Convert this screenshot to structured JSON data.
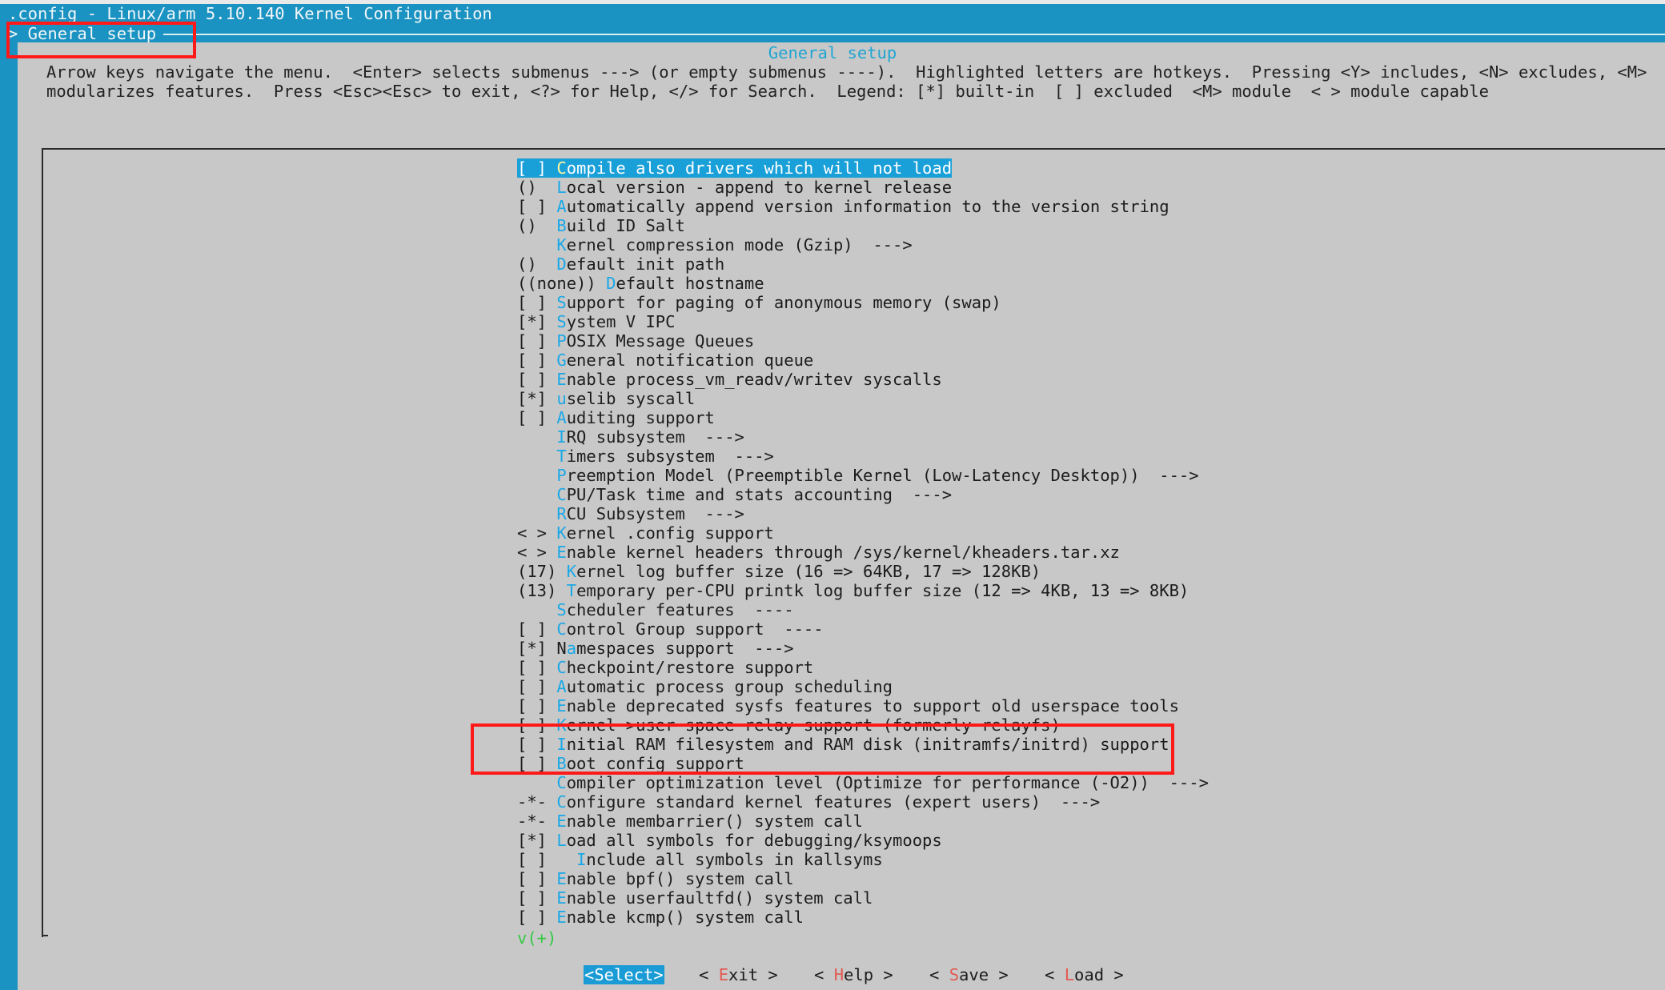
{
  "window": {
    "title": ".config - Linux/arm 5.10.140 Kernel Configuration"
  },
  "breadcrumb": {
    "text": "> General setup"
  },
  "panel": {
    "title": "General setup",
    "help_line_1": "Arrow keys navigate the menu.  <Enter> selects submenus ---> (or empty submenus ----).  Highlighted letters are hotkeys.  Pressing <Y> includes, <N> excludes, <M>",
    "help_line_2": "modularizes features.  Press <Esc><Esc> to exit, <?> for Help, </> for Search.  Legend: [*] built-in  [ ] excluded  <M> module  < > module capable"
  },
  "menu": {
    "items": [
      {
        "prefix": "[ ] ",
        "hotkey": "C",
        "rest": "ompile also drivers which will not load"
      },
      {
        "prefix": "()  ",
        "hotkey": "L",
        "rest": "ocal version - append to kernel release"
      },
      {
        "prefix": "[ ] ",
        "hotkey": "A",
        "rest": "utomatically append version information to the version string"
      },
      {
        "prefix": "()  ",
        "hotkey": "B",
        "rest": "uild ID Salt"
      },
      {
        "prefix": "    ",
        "hotkey": "K",
        "rest": "ernel compression mode (Gzip)  --->"
      },
      {
        "prefix": "()  ",
        "hotkey": "D",
        "rest": "efault init path"
      },
      {
        "prefix": "((none)) ",
        "hotkey": "D",
        "rest": "efault hostname"
      },
      {
        "prefix": "[ ] ",
        "hotkey": "S",
        "rest": "upport for paging of anonymous memory (swap)"
      },
      {
        "prefix": "[*] ",
        "hotkey": "S",
        "rest": "ystem V IPC"
      },
      {
        "prefix": "[ ] ",
        "hotkey": "P",
        "rest": "OSIX Message Queues"
      },
      {
        "prefix": "[ ] ",
        "hotkey": "G",
        "rest": "eneral notification queue"
      },
      {
        "prefix": "[ ] ",
        "hotkey": "E",
        "rest": "nable process_vm_readv/writev syscalls"
      },
      {
        "prefix": "[*] ",
        "hotkey": "u",
        "rest": "selib syscall"
      },
      {
        "prefix": "[ ] ",
        "hotkey": "A",
        "rest": "uditing support"
      },
      {
        "prefix": "    ",
        "hotkey": "I",
        "rest": "RQ subsystem  --->"
      },
      {
        "prefix": "    ",
        "hotkey": "T",
        "rest": "imers subsystem  --->"
      },
      {
        "prefix": "    ",
        "hotkey": "P",
        "rest": "reemption Model (Preemptible Kernel (Low-Latency Desktop))  --->"
      },
      {
        "prefix": "    ",
        "hotkey": "C",
        "rest": "PU/Task time and stats accounting  --->"
      },
      {
        "prefix": "    ",
        "hotkey": "R",
        "rest": "CU Subsystem  --->"
      },
      {
        "prefix": "< > ",
        "hotkey": "K",
        "rest": "ernel .config support"
      },
      {
        "prefix": "< > ",
        "hotkey": "E",
        "rest": "nable kernel headers through /sys/kernel/kheaders.tar.xz"
      },
      {
        "prefix": "(17) ",
        "hotkey": "K",
        "rest": "ernel log buffer size (16 => 64KB, 17 => 128KB)"
      },
      {
        "prefix": "(13) ",
        "hotkey": "T",
        "rest": "emporary per-CPU printk log buffer size (12 => 4KB, 13 => 8KB)"
      },
      {
        "prefix": "    ",
        "hotkey": "S",
        "rest": "cheduler features  ----"
      },
      {
        "prefix": "[ ] ",
        "hotkey": "C",
        "rest": "ontrol Group support  ----"
      },
      {
        "prefix": "[*] N",
        "hotkey": "a",
        "rest": "mespaces support  --->"
      },
      {
        "prefix": "[ ] ",
        "hotkey": "C",
        "rest": "heckpoint/restore support"
      },
      {
        "prefix": "[ ] ",
        "hotkey": "A",
        "rest": "utomatic process group scheduling"
      },
      {
        "prefix": "[ ] ",
        "hotkey": "E",
        "rest": "nable deprecated sysfs features to support old userspace tools"
      },
      {
        "prefix": "[ ] ",
        "hotkey": "K",
        "rest": "ernel->user space relay support (formerly relayfs)"
      },
      {
        "prefix": "[ ] ",
        "hotkey": "I",
        "rest": "nitial RAM filesystem and RAM disk (initramfs/initrd) support"
      },
      {
        "prefix": "[ ] ",
        "hotkey": "B",
        "rest": "oot config support"
      },
      {
        "prefix": "    ",
        "hotkey": "C",
        "rest": "ompiler optimization level (Optimize for performance (-O2))  --->"
      },
      {
        "prefix": "-*- ",
        "hotkey": "C",
        "rest": "onfigure standard kernel features (expert users)  --->"
      },
      {
        "prefix": "-*- ",
        "hotkey": "E",
        "rest": "nable membarrier() system call"
      },
      {
        "prefix": "[*] ",
        "hotkey": "L",
        "rest": "oad all symbols for debugging/ksymoops"
      },
      {
        "prefix": "[ ]   ",
        "hotkey": "I",
        "rest": "nclude all symbols in kallsyms"
      },
      {
        "prefix": "[ ] ",
        "hotkey": "E",
        "rest": "nable bpf() system call"
      },
      {
        "prefix": "[ ] ",
        "hotkey": "E",
        "rest": "nable userfaultfd() system call"
      },
      {
        "prefix": "[ ] ",
        "hotkey": "E",
        "rest": "nable kcmp() system call"
      }
    ],
    "more_indicator": "v(+)"
  },
  "buttons": {
    "select": "<Select>",
    "exit": {
      "open": "< ",
      "hotkey": "E",
      "rest": "xit",
      "close": " >"
    },
    "help": {
      "open": "< ",
      "hotkey": "H",
      "rest": "elp",
      "close": " >"
    },
    "save": {
      "open": "< ",
      "hotkey": "S",
      "rest": "ave",
      "close": " >"
    },
    "load": {
      "open": "< ",
      "hotkey": "L",
      "rest": "oad",
      "close": " >"
    }
  },
  "colors": {
    "terminal_blue": "#1a93c2",
    "panel_gray": "#c8c8c8",
    "hotkey_blue": "#1aa8e6",
    "button_hotkey_red": "#e25a52",
    "annotation_red": "#ff1a1a",
    "more_green": "#35c845"
  }
}
